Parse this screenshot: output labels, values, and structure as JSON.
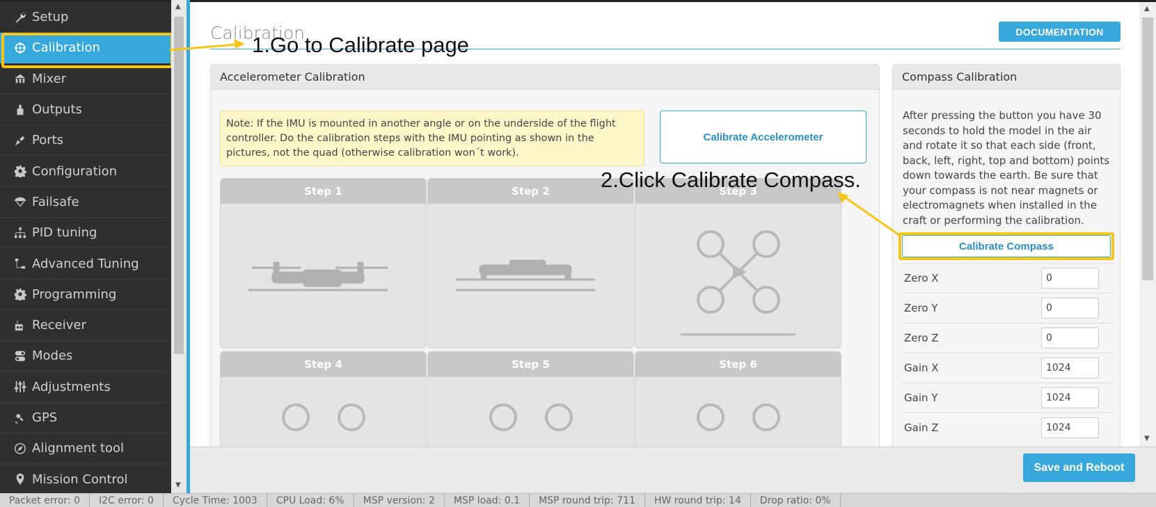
{
  "sidebar": {
    "items": [
      {
        "label": "Setup",
        "icon": "wrench-icon"
      },
      {
        "label": "Calibration",
        "icon": "crosshair-icon"
      },
      {
        "label": "Mixer",
        "icon": "mixer-icon"
      },
      {
        "label": "Outputs",
        "icon": "outputs-icon"
      },
      {
        "label": "Ports",
        "icon": "ports-icon"
      },
      {
        "label": "Configuration",
        "icon": "gear-icon"
      },
      {
        "label": "Failsafe",
        "icon": "parachute-icon"
      },
      {
        "label": "PID tuning",
        "icon": "pid-icon"
      },
      {
        "label": "Advanced Tuning",
        "icon": "advanced-icon"
      },
      {
        "label": "Programming",
        "icon": "gear-icon"
      },
      {
        "label": "Receiver",
        "icon": "receiver-icon"
      },
      {
        "label": "Modes",
        "icon": "toggle-icon"
      },
      {
        "label": "Adjustments",
        "icon": "sliders-icon"
      },
      {
        "label": "GPS",
        "icon": "satellite-icon"
      },
      {
        "label": "Alignment tool",
        "icon": "compass-icon"
      },
      {
        "label": "Mission Control",
        "icon": "map-pin-icon"
      }
    ]
  },
  "header": {
    "title": "Calibration",
    "documentation_label": "DOCUMENTATION"
  },
  "accelerometer": {
    "title": "Accelerometer Calibration",
    "note": "Note: If the IMU is mounted in another angle or on the underside of the flight controller. Do the calibration steps with the IMU pointing as shown in the pictures, not the quad (otherwise calibration won´t work).",
    "button_label": "Calibrate Accelerometer",
    "steps": [
      "Step 1",
      "Step 2",
      "Step 3",
      "Step 4",
      "Step 5",
      "Step 6"
    ]
  },
  "compass": {
    "title": "Compass Calibration",
    "description": "After pressing the button you have 30 seconds to hold the model in the air and rotate it so that each side (front, back, left, right, top and bottom) points down towards the earth. Be sure that your compass is not near magnets or electromagnets when installed in the craft or performing the calibration.",
    "button_label": "Calibrate Compass",
    "fields": [
      {
        "label": "Zero X",
        "value": "0"
      },
      {
        "label": "Zero Y",
        "value": "0"
      },
      {
        "label": "Zero Z",
        "value": "0"
      },
      {
        "label": "Gain X",
        "value": "1024"
      },
      {
        "label": "Gain Y",
        "value": "1024"
      },
      {
        "label": "Gain Z",
        "value": "1024"
      }
    ]
  },
  "footer": {
    "save_label": "Save and Reboot"
  },
  "status_bar": [
    "Packet error: 0",
    "I2C error: 0",
    "Cycle Time: 1003",
    "CPU Load: 6%",
    "MSP version: 2",
    "MSP load: 0.1",
    "MSP round trip: 711",
    "HW round trip: 14",
    "Drop ratio: 0%"
  ],
  "annotations": {
    "step1": "1.Go to Calibrate page",
    "step2": "2.Click Calibrate Compass."
  },
  "colors": {
    "accent": "#37a8db",
    "highlight": "#f5c518",
    "sidebar_bg": "#2f2f2f"
  }
}
